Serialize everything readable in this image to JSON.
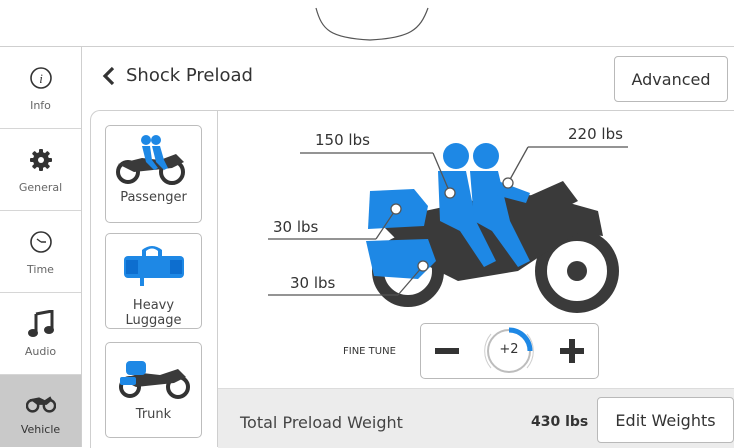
{
  "sidebar": {
    "items": [
      {
        "label": "Info",
        "icon": "info-icon"
      },
      {
        "label": "General",
        "icon": "gear-icon"
      },
      {
        "label": "Time",
        "icon": "clock-icon"
      },
      {
        "label": "Audio",
        "icon": "music-note-icon"
      },
      {
        "label": "Vehicle",
        "icon": "motorcycle-icon",
        "active": true
      }
    ]
  },
  "header": {
    "title": "Shock Preload",
    "advanced_label": "Advanced"
  },
  "presets": [
    {
      "label": "Passenger"
    },
    {
      "label": "Heavy\nLuggage"
    },
    {
      "label": "Trunk"
    }
  ],
  "diagram": {
    "weights": {
      "rider": "150 lbs",
      "passenger": "220 lbs",
      "saddlebag_upper": "30 lbs",
      "saddlebag_lower": "30 lbs"
    }
  },
  "fine_tune": {
    "label": "FINE TUNE",
    "value": "+2"
  },
  "total": {
    "label": "Total Preload Weight",
    "value": "430 lbs",
    "edit_label": "Edit Weights"
  },
  "colors": {
    "accent_blue": "#1e88e5",
    "dark_gray": "#3a3a3a",
    "active_tab": "#c9c9c9"
  }
}
